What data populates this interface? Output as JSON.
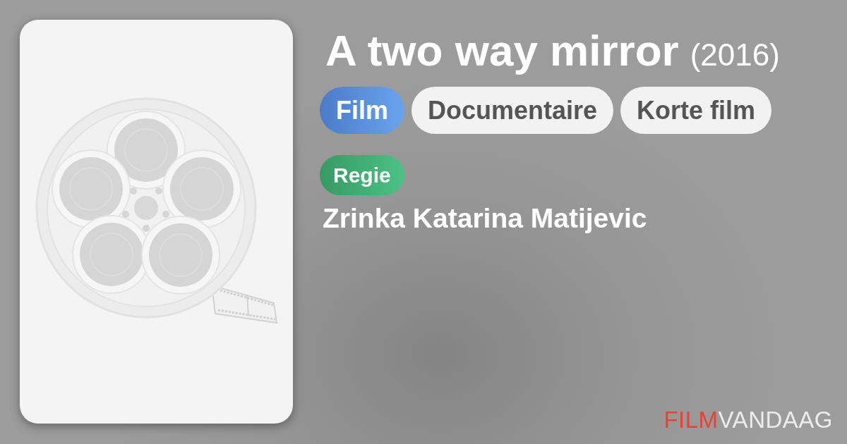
{
  "title": "A two way mirror",
  "year": "(2016)",
  "tags": [
    {
      "label": "Film",
      "kind": "medium"
    },
    {
      "label": "Documentaire",
      "kind": "genre"
    },
    {
      "label": "Korte film",
      "kind": "genre"
    }
  ],
  "credits": [
    {
      "role": "Regie",
      "names": [
        "Zrinka Katarina Matijevic"
      ]
    }
  ],
  "logo": {
    "part_1": "FILM",
    "part_2": "VANDAAG"
  }
}
